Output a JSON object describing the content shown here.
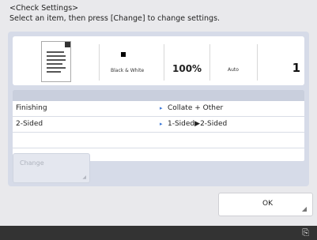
{
  "header": {
    "title": "<Check Settings>",
    "instruction": "Select an item, then press [Change] to change settings."
  },
  "summary": {
    "color_mode": "Black & White",
    "zoom": "100%",
    "paper": "Auto",
    "copies": "1"
  },
  "settings": {
    "rows": [
      {
        "name": "Finishing",
        "value": "Collate + Other"
      },
      {
        "name": "2-Sided",
        "value": "1-Sided▶2-Sided"
      }
    ]
  },
  "buttons": {
    "change": "Change",
    "ok": "OK"
  },
  "icons": {
    "arrow": "▸",
    "corner_mark": "◢",
    "status": "⎘"
  }
}
